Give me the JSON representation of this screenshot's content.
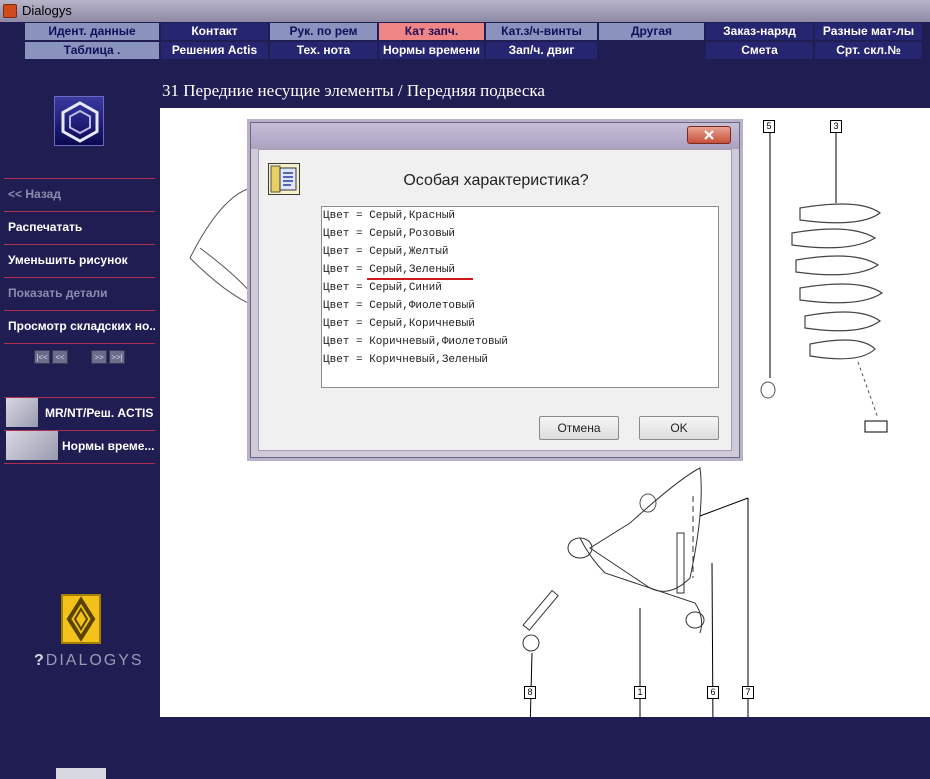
{
  "window": {
    "title": "Dialogys"
  },
  "menu": {
    "row1": [
      "Идент. данные",
      "Контакт",
      "Рук. по рем",
      "Кат запч.",
      "Кат.з/ч-винты",
      "Другая",
      "Заказ-наряд",
      "Разные мат-лы"
    ],
    "row2": [
      "Таблица .",
      "Решения Actis",
      "Тех. нота",
      "Нормы времени",
      "Зап/ч. двиг",
      "Смета",
      "Срт. скл.№"
    ]
  },
  "sidebar": {
    "items": [
      "<< Назад",
      "Распечатать",
      "Уменьшить рисунок",
      "Показать детали",
      "Просмотр складских но..."
    ],
    "nav_buttons": [
      "|<<",
      "<<",
      ">>",
      ">>|"
    ],
    "actis_links": [
      "MR/NT/Реш. ACTIS",
      "Нормы време..."
    ],
    "dialogys_logo": "DIALOGYS"
  },
  "page": {
    "heading": "31 Передние несущие элементы / Передняя подвеска"
  },
  "callouts": [
    "5",
    "3",
    "8",
    "1",
    "6",
    "7"
  ],
  "dialog": {
    "question": "Особая характеристика?",
    "options": [
      "Цвет = Серый,Красный",
      "Цвет = Серый,Розовый",
      "Цвет = Серый,Желтый",
      "Цвет = Серый,Зеленый",
      "Цвет = Серый,Синий",
      "Цвет = Серый,Фиолетовый",
      "Цвет = Серый,Коричневый",
      "Цвет = Коричневый,Фиолетовый",
      "Цвет = Коричневый,Зеленый"
    ],
    "cancel_label": "Отмена",
    "ok_label": "OK"
  }
}
